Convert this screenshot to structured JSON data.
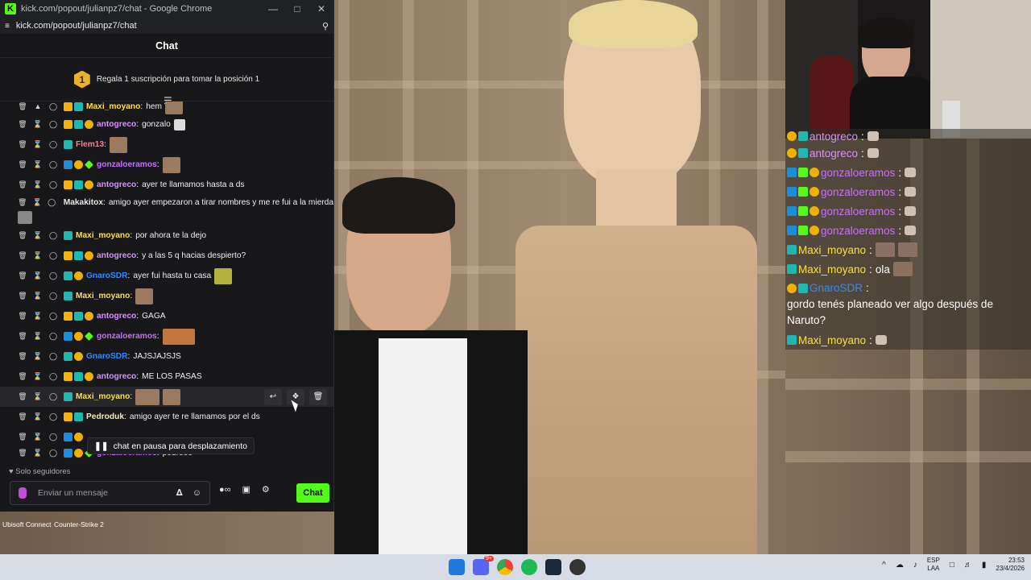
{
  "browser": {
    "window_title": "kick.com/popout/julianpz7/chat - Google Chrome",
    "url": "kick.com/popout/julianpz7/chat",
    "zoom_icon": "zoom-icon"
  },
  "chat": {
    "header": "Chat",
    "banner_rank": "1",
    "banner_text": "Regala 1 suscripción para tomar la posición 1",
    "messages": [
      {
        "user": "Maxi_moyano",
        "text": "hem",
        "color": "#53fc18"
      },
      {
        "user": "antogreco",
        "text": "gonzalo",
        "color": "#d593f8"
      },
      {
        "user": "Flem13",
        "text": "",
        "color": "#ff7a9a"
      },
      {
        "user": "gonzaloeramos",
        "text": "",
        "color": "#c76dff"
      },
      {
        "user": "antogreco",
        "text": "ayer te llamamos hasta a ds",
        "color": "#d593f8"
      },
      {
        "user": "Makakitox",
        "text": "amigo ayer empezaron a tirar nombres y me re fui a la mierda",
        "color": "#e8e8e8"
      },
      {
        "user": "Maxi_moyano",
        "text": "por ahora te la dejo",
        "color": "#f7e04a"
      },
      {
        "user": "antogreco",
        "text": "y a las 5 q hacias despierto?",
        "color": "#d593f8"
      },
      {
        "user": "GnaroSDR",
        "text": "ayer fui hasta tu casa",
        "color": "#2b8cff"
      },
      {
        "user": "Maxi_moyano",
        "text": "",
        "color": "#f7e04a"
      },
      {
        "user": "antogreco",
        "text": "GAGA",
        "color": "#d593f8"
      },
      {
        "user": "gonzaloeramos",
        "text": "",
        "color": "#c76dff"
      },
      {
        "user": "GnaroSDR",
        "text": "JAJSJAJSJS",
        "color": "#2b8cff"
      },
      {
        "user": "antogreco",
        "text": "ME LOS PASAS",
        "color": "#d593f8"
      },
      {
        "user": "Maxi_moyano",
        "text": "",
        "color": "#f7e04a"
      },
      {
        "user": "Pedroduk",
        "text": "amigo ayer te re llamamos por el ds",
        "color": "#f4e9c1"
      },
      {
        "user": "",
        "text": "",
        "color": "#ffffff"
      },
      {
        "user": "gonzaloeramos",
        "text": "pedrooo",
        "color": "#c76dff"
      }
    ],
    "pause_text": "chat en pausa para desplazamiento",
    "followers_only": "Solo seguidores",
    "input_placeholder": "Enviar un mensaje",
    "send_label": "Chat"
  },
  "desktop_icons": [
    "Ubisoft Connect",
    "Counter-Strike 2"
  ],
  "overlay_chat": [
    {
      "user": "antogreco",
      "text": "",
      "color": "#d593f8"
    },
    {
      "user": "antogreco",
      "text": "",
      "color": "#d593f8"
    },
    {
      "user": "gonzaloeramos",
      "text": "",
      "color": "#c76dff"
    },
    {
      "user": "gonzaloeramos",
      "text": "",
      "color": "#c76dff"
    },
    {
      "user": "gonzaloeramos",
      "text": "",
      "color": "#c76dff"
    },
    {
      "user": "gonzaloeramos",
      "text": "",
      "color": "#c76dff"
    },
    {
      "user": "Maxi_moyano",
      "text": "",
      "color": "#f7e04a"
    },
    {
      "user": "Maxi_moyano",
      "text": "ola",
      "color": "#f7e04a"
    },
    {
      "user": "GnaroSDR",
      "text": "gordo tenés planeado ver algo después de Naruto?",
      "color": "#2b8cff"
    },
    {
      "user": "Maxi_moyano",
      "text": "",
      "color": "#f7e04a"
    }
  ],
  "taskbar": {
    "lang_line1": "ESP",
    "lang_line2": "LAA",
    "time": "23:53",
    "date": "23/4/2026",
    "discord_badge": "9+"
  },
  "colors": {
    "kick_green": "#53fc18",
    "chat_bg": "#18181b"
  }
}
